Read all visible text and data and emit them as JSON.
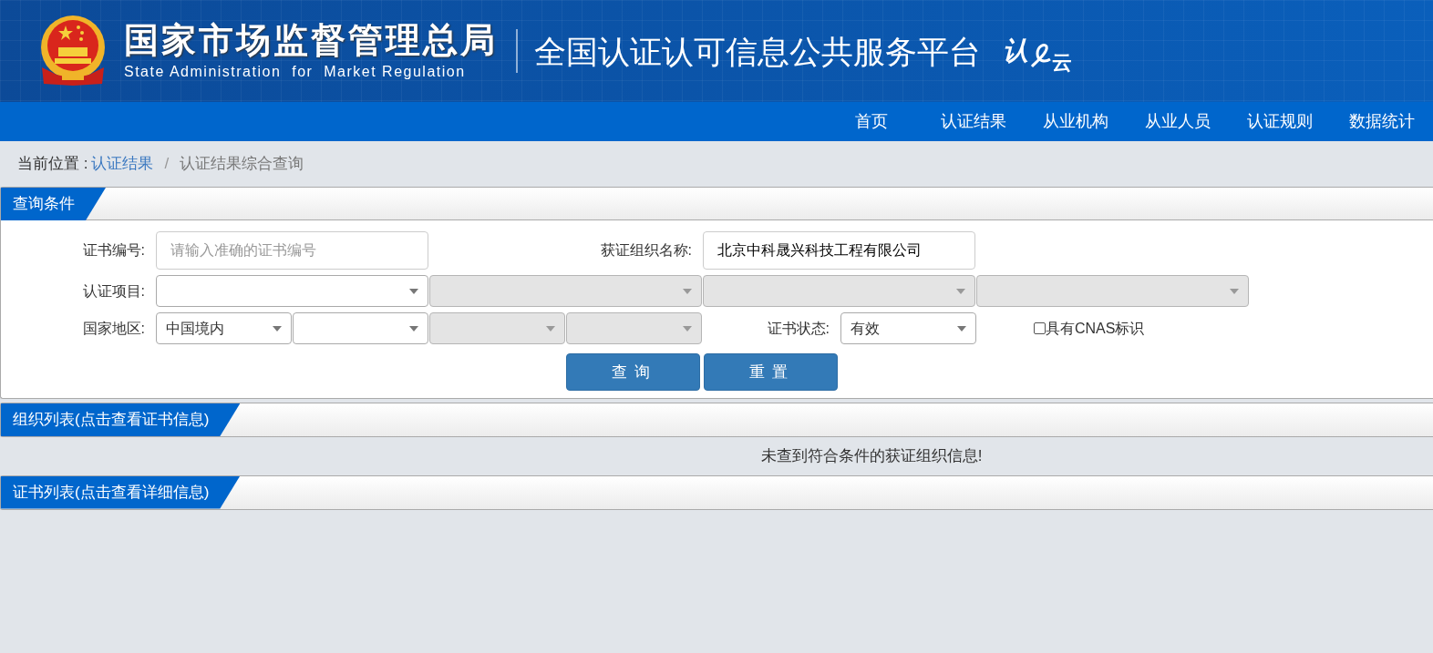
{
  "header": {
    "agency_cn": "国家市场监督管理总局",
    "agency_en": "State Administration  for  Market Regulation",
    "platform": "全国认证认可信息公共服务平台",
    "logo_chars": [
      "认",
      "云"
    ]
  },
  "nav": [
    {
      "label": "首页"
    },
    {
      "label": "认证结果"
    },
    {
      "label": "从业机构"
    },
    {
      "label": "从业人员"
    },
    {
      "label": "认证规则"
    },
    {
      "label": "数据统计"
    }
  ],
  "breadcrumb": {
    "prefix": "当前位置 :",
    "separator": "/",
    "items": [
      {
        "label": "认证结果",
        "kind": "link"
      },
      {
        "label": "认证结果综合查询",
        "kind": "current"
      }
    ]
  },
  "query": {
    "title": "查询条件",
    "rows": [
      {
        "controls": [
          {
            "kind": "label",
            "text": "证书编号:"
          },
          {
            "kind": "input",
            "placeholder": "请输入准确的证书编号"
          },
          {
            "kind": "label",
            "text": "获证组织名称:"
          },
          {
            "kind": "input",
            "value": "北京中科晟兴科技工程有限公司"
          }
        ]
      },
      {
        "controls": [
          {
            "kind": "label",
            "text": "认证项目:"
          },
          {
            "kind": "select",
            "disabled": false
          },
          {
            "kind": "select",
            "disabled": true
          },
          {
            "kind": "select",
            "disabled": true
          },
          {
            "kind": "select",
            "disabled": true
          }
        ]
      },
      {
        "controls": [
          {
            "kind": "label",
            "text": "国家地区:"
          },
          {
            "kind": "select",
            "value": "中国境内",
            "disabled": false
          },
          {
            "kind": "select",
            "disabled": false
          },
          {
            "kind": "select",
            "disabled": true
          },
          {
            "kind": "select",
            "disabled": true
          },
          {
            "kind": "label",
            "text": "证书状态:"
          },
          {
            "kind": "select",
            "value": "有效",
            "disabled": false
          },
          {
            "kind": "checkbox",
            "text": "具有CNAS标识",
            "checked": false
          }
        ]
      }
    ],
    "buttons": [
      "查询",
      "重置"
    ]
  },
  "org_list": {
    "title": "组织列表(点击查看证书信息)",
    "message": "未查到符合条件的获证组织信息!"
  },
  "cert_list": {
    "title": "证书列表(点击查看详细信息)"
  }
}
